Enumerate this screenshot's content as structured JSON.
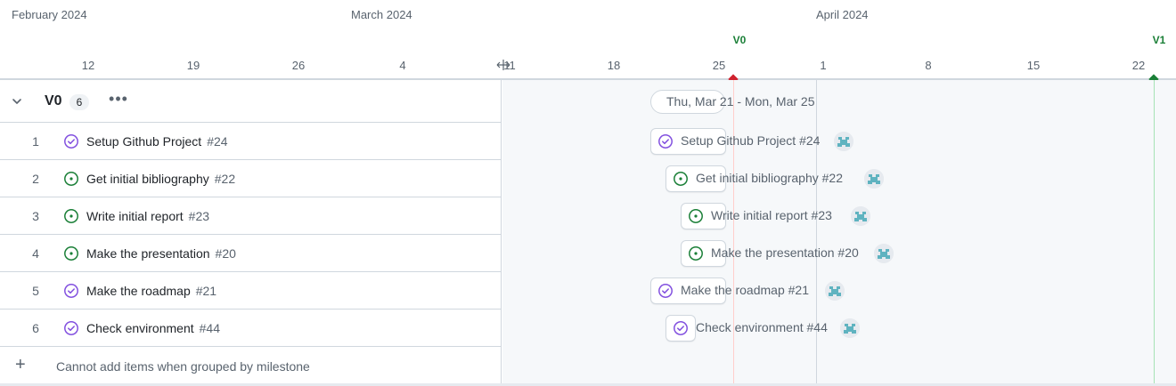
{
  "header": {
    "months": [
      "February 2024",
      "March 2024",
      "April 2024"
    ],
    "days": [
      "12",
      "19",
      "26",
      "4",
      "11",
      "18",
      "25",
      "1",
      "8",
      "15",
      "22"
    ],
    "milestones": [
      {
        "label": "V0",
        "color": "#cf222e"
      },
      {
        "label": "V1",
        "color": "#1a7f37"
      }
    ]
  },
  "group": {
    "title": "V0",
    "count": "6",
    "date_range": "Thu, Mar 21 - Mon, Mar 25"
  },
  "items": [
    {
      "index": "1",
      "title": "Setup Github Project",
      "number": "#24",
      "status": "done"
    },
    {
      "index": "2",
      "title": "Get initial bibliography",
      "number": "#22",
      "status": "open"
    },
    {
      "index": "3",
      "title": "Write initial report",
      "number": "#23",
      "status": "open"
    },
    {
      "index": "4",
      "title": "Make the presentation",
      "number": "#20",
      "status": "open"
    },
    {
      "index": "5",
      "title": "Make the roadmap",
      "number": "#21",
      "status": "done"
    },
    {
      "index": "6",
      "title": "Check environment",
      "number": "#44",
      "status": "done"
    }
  ],
  "bars": [
    {
      "label": "Setup Github Project #24"
    },
    {
      "label": "Get initial bibliography #22"
    },
    {
      "label": "Write initial report #23"
    },
    {
      "label": "Make the presentation #20"
    },
    {
      "label": "Make the roadmap #21"
    },
    {
      "label": "Check environment #44"
    }
  ],
  "add_row": {
    "text": "Cannot add items when grouped by milestone"
  },
  "icons": {
    "chevron": "chevron-down-icon",
    "more": "kebab-horizontal-icon",
    "plus": "plus-icon",
    "status_done": "issue-closed-icon",
    "status_open": "issue-opened-icon",
    "avatar": "identicon-avatar"
  },
  "colors": {
    "done": "#8250df",
    "open": "#1a7f37",
    "today_line": "#cf222e",
    "v1_line": "#1a7f37"
  }
}
